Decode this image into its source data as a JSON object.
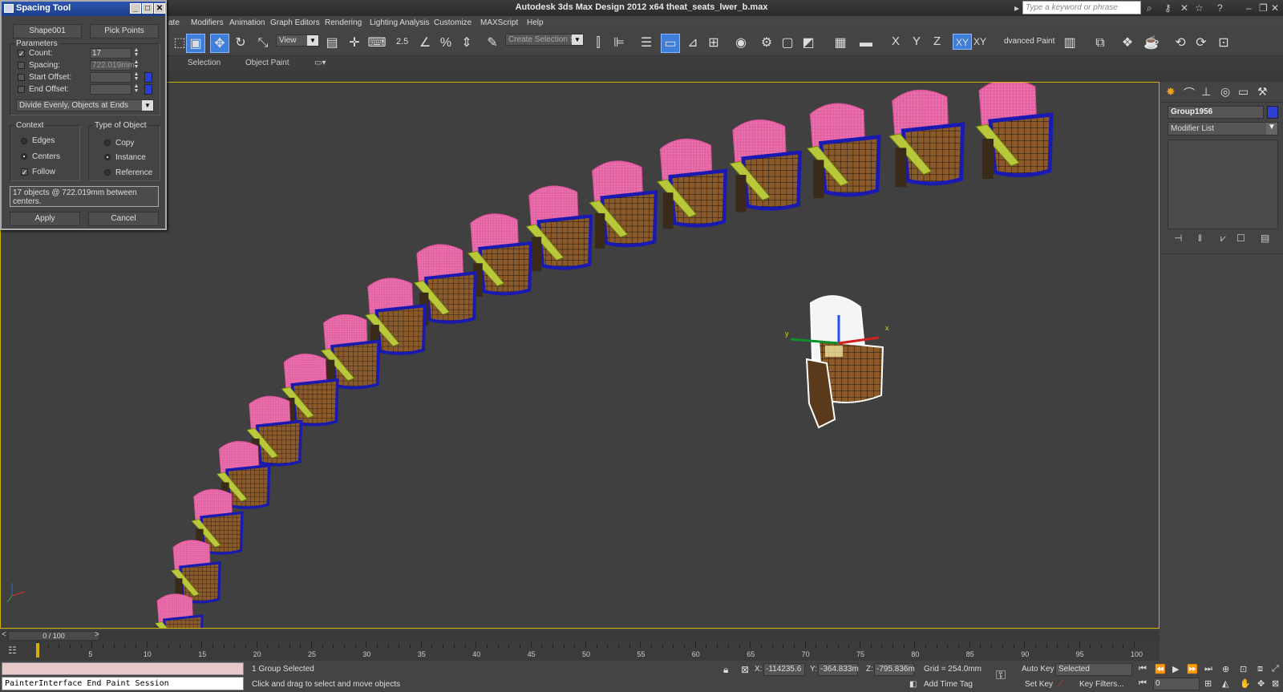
{
  "app": {
    "title": "Autodesk 3ds Max Design 2012 x64     theat_seats_lwer_b.max",
    "search_placeholder": "Type a keyword or phrase"
  },
  "menu": [
    "ate",
    "Modifiers",
    "Animation",
    "Graph Editors",
    "Rendering",
    "Lighting Analysis",
    "Customize",
    "MAXScript",
    "Help"
  ],
  "toolbar": {
    "view_dropdown": "View",
    "snap_label": "2.5",
    "selection_set": "Create Selection Se",
    "axes": [
      "X",
      "Y",
      "Z",
      "XY",
      "XY"
    ],
    "advanced_paint": "dvanced Paint"
  },
  "ribbon_tabs": [
    "Selection",
    "Object Paint"
  ],
  "spacing_tool": {
    "title": "Spacing Tool",
    "shape_button": "Shape001",
    "pick_points_button": "Pick Points",
    "parameters_label": "Parameters",
    "count_label": "Count:",
    "count_value": "17",
    "spacing_label": "Spacing:",
    "spacing_value": "722.019mm",
    "start_offset_label": "Start Offset:",
    "end_offset_label": "End Offset:",
    "mode_dropdown": "Divide Evenly, Objects at Ends",
    "context_label": "Context",
    "context_options": [
      "Edges",
      "Centers",
      "Follow"
    ],
    "type_label": "Type of Object",
    "type_options": [
      "Copy",
      "Instance",
      "Reference"
    ],
    "info_text": "17 objects @ 722.019mm  between centers.",
    "apply_button": "Apply",
    "cancel_button": "Cancel",
    "checks": {
      "count": true,
      "spacing": false,
      "start_offset": false,
      "end_offset": false,
      "follow": true
    },
    "context_selected": "Centers",
    "type_selected": "Instance"
  },
  "command_panel": {
    "object_name": "Group1956",
    "object_color": "#2d3fd0",
    "modifier_list": "Modifier List"
  },
  "viewport": {
    "gizmo_labels": [
      "y",
      "x"
    ]
  },
  "time": {
    "slider": "0 / 100",
    "ticks": [
      "5",
      "10",
      "15",
      "20",
      "25",
      "30",
      "35",
      "40",
      "45",
      "50",
      "55",
      "60",
      "65",
      "70",
      "75",
      "80",
      "85",
      "90",
      "95",
      "100"
    ]
  },
  "status": {
    "maxscript_output": "PainterInterface End Paint Session",
    "selection_status": "1 Group Selected",
    "prompt": "Click and drag to select and move objects",
    "x_label": "X:",
    "x_value": "-114235.6",
    "y_label": "Y:",
    "y_value": "-364.833m",
    "z_label": "Z:",
    "z_value": "-795.836m",
    "grid": "Grid = 254.0mm",
    "add_time_tag": "Add Time Tag",
    "auto_key": "Auto Key",
    "set_key": "Set Key",
    "selected_dropdown": "Selected",
    "key_filters": "Key Filters...",
    "frame_value": "0"
  }
}
